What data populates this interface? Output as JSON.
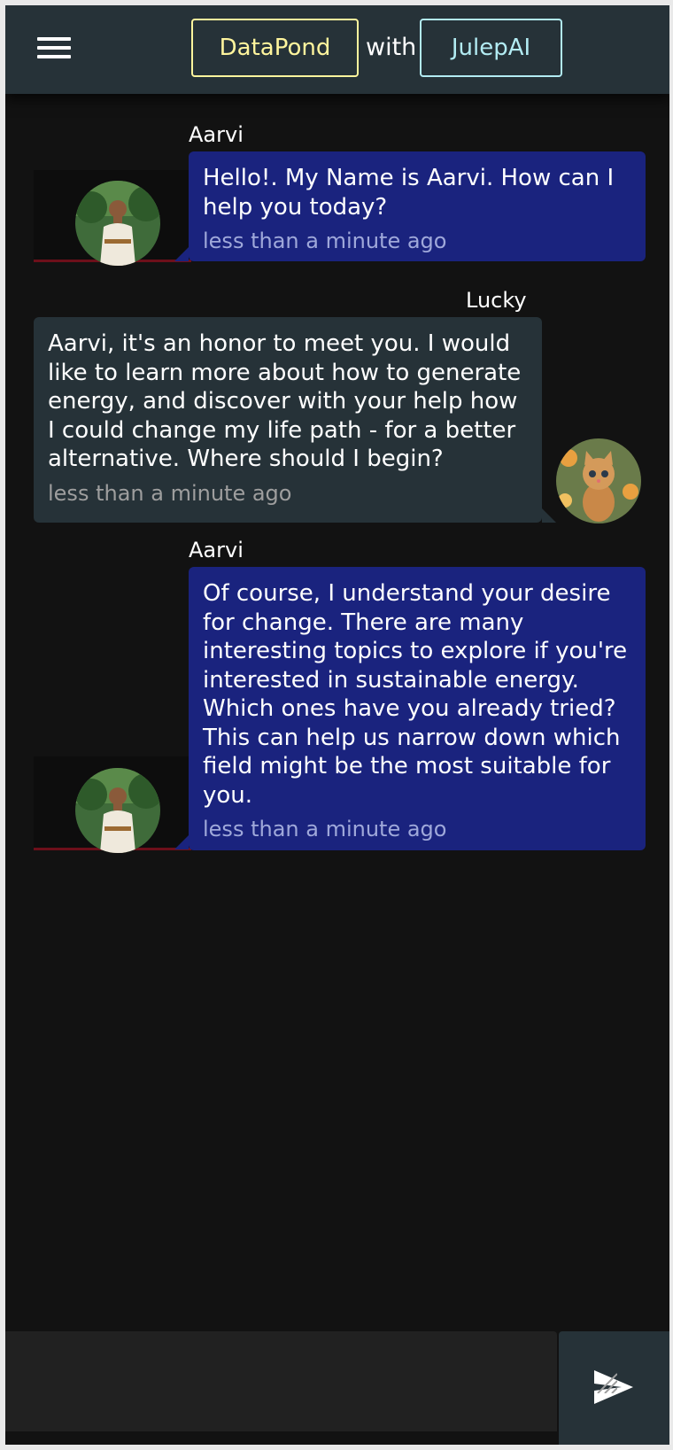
{
  "header": {
    "menu_icon": "hamburger-menu-icon",
    "left_brand": "DataPond",
    "connector": "with",
    "right_brand": "JulepAI",
    "colors": {
      "background": "#263238",
      "left_brand": "#fff59d",
      "right_brand": "#b2ebf2"
    }
  },
  "messages": [
    {
      "sender": "Aarvi",
      "role": "ai",
      "text": "Hello!. My Name is Aarvi. How can I help you today?",
      "time": "less than a minute ago",
      "avatar": "man-portrait-avatar"
    },
    {
      "sender": "Lucky",
      "role": "user",
      "text": "Aarvi, it's an honor to meet you. I would like to learn more about how to generate energy, and discover with your help how I could change my life path - for a better alternative. Where should I begin?",
      "time": "less than a minute ago",
      "avatar": "kitten-avatar"
    },
    {
      "sender": "Aarvi",
      "role": "ai",
      "text": "Of course, I understand your desire for change. There are many interesting topics to explore if you're interested in sustainable energy. Which ones have you already tried? This can help us narrow down which field might be the most suitable for you.",
      "time": "less than a minute ago",
      "avatar": "man-portrait-avatar"
    }
  ],
  "composer": {
    "value": "",
    "send_icon": "send-icon"
  },
  "colors": {
    "page_background": "#121212",
    "ai_bubble": "#1a237e",
    "user_bubble": "#263238",
    "ai_time": "#9fa8da",
    "user_time": "#9e9e9e"
  }
}
